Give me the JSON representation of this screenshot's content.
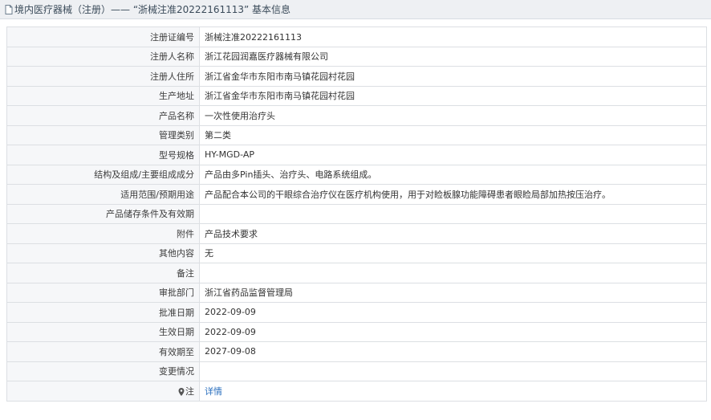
{
  "header": {
    "title": "境内医疗器械（注册）—— “浙械注准20222161113” 基本信息"
  },
  "rows": [
    {
      "label": "注册证编号",
      "value": "浙械注准20222161113"
    },
    {
      "label": "注册人名称",
      "value": "浙江花园润嘉医疗器械有限公司"
    },
    {
      "label": "注册人住所",
      "value": "浙江省金华市东阳市南马镇花园村花园"
    },
    {
      "label": "生产地址",
      "value": "浙江省金华市东阳市南马镇花园村花园"
    },
    {
      "label": "产品名称",
      "value": "一次性使用治疗头"
    },
    {
      "label": "管理类别",
      "value": "第二类"
    },
    {
      "label": "型号规格",
      "value": "HY-MGD-AP"
    },
    {
      "label": "结构及组成/主要组成成分",
      "value": "产品由多Pin插头、治疗头、电路系统组成。"
    },
    {
      "label": "适用范围/预期用途",
      "value": "产品配合本公司的干眼综合治疗仪在医疗机构使用，用于对睑板腺功能障碍患者眼睑局部加热按压治疗。"
    },
    {
      "label": "产品储存条件及有效期",
      "value": ""
    },
    {
      "label": "附件",
      "value": "产品技术要求"
    },
    {
      "label": "其他内容",
      "value": "无"
    },
    {
      "label": "备注",
      "value": ""
    },
    {
      "label": "审批部门",
      "value": "浙江省药品监督管理局"
    },
    {
      "label": "批准日期",
      "value": "2022-09-09"
    },
    {
      "label": "生效日期",
      "value": "2022-09-09"
    },
    {
      "label": "有效期至",
      "value": "2027-09-08"
    },
    {
      "label": "变更情况",
      "value": ""
    }
  ],
  "note_row": {
    "label": "注",
    "link_text": "详情"
  },
  "colors": {
    "header_bg": "#eef0f3",
    "label_bg": "#f6f7f9",
    "border": "#dcdfe3",
    "link": "#2a6fbe"
  }
}
